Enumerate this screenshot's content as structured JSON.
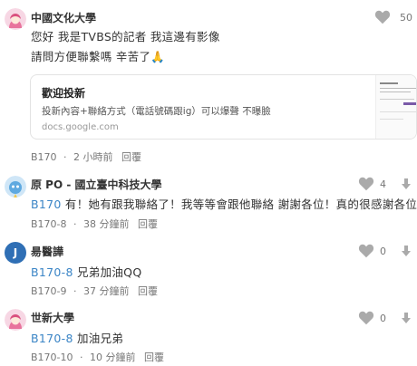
{
  "comments": [
    {
      "author": "中國文化大學",
      "line1": "您好 我是TVBS的記者 我這邊有影像",
      "line2": "請問方便聯繫嗎 辛苦了🙏",
      "likes": "50",
      "floor": "B170",
      "time": "2 小時前",
      "reply": "回覆",
      "avatar_icon": "pink-hood-avatar-icon",
      "link_card": {
        "title": "歡迎投新",
        "description": "投新內容+聯絡方式（電話號碼跟ig）可以爆聲 不曝臉",
        "domain": "docs.google.com"
      }
    },
    {
      "author": "原 PO - 國立臺中科技大學",
      "ref": "B170",
      "text": " 有！她有跟我聯絡了！我等等會跟他聯絡 謝謝各位！真的很感謝各位",
      "likes": "4",
      "floor": "B170-8",
      "time": "38 分鐘前",
      "reply": "回覆",
      "avatar_icon": "blue-creature-avatar-icon"
    },
    {
      "author": "昜醫譁",
      "avatar_letter": "J",
      "ref": "B170-8",
      "text": " 兄弟加油QQ",
      "likes": "0",
      "floor": "B170-9",
      "time": "37 分鐘前",
      "reply": "回覆",
      "avatar_color": "#2f6fb5"
    },
    {
      "author": "世新大學",
      "ref": "B170-8",
      "text": " 加油兄弟",
      "likes": "0",
      "floor": "B170-10",
      "time": "10 分鐘前",
      "reply": "回覆",
      "avatar_icon": "pink-hood-avatar-icon"
    }
  ],
  "colors": {
    "reference_link": "#3b85c6",
    "heart_icon": "#aaaaaa"
  }
}
